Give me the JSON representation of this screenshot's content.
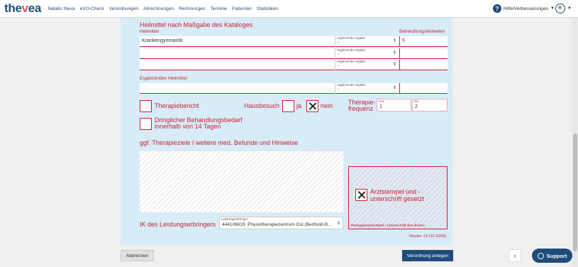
{
  "header": {
    "logo_main": "the",
    "logo_accent": "v",
    "logo_tail": "ea",
    "nav": [
      "Natalis theva",
      "eVO-Check",
      "Verordnungen",
      "Abrechnungen",
      "Rechnungen",
      "Termine",
      "Patienten",
      "Statistiken"
    ],
    "help_label": "Hilfe/Verbesserungen",
    "help_icon": "?"
  },
  "form": {
    "section_title": "Heilmittel nach Maßgabe des Kataloges",
    "heilmittel_label": "Heilmittel",
    "units_label": "Behandlungseinheiten",
    "rows": [
      {
        "heilmittel": "Krankengymnastik",
        "ergaenzend_caption": "ergänzende Angabe",
        "ergaenzend_value": "-",
        "units": "6"
      },
      {
        "heilmittel": "",
        "ergaenzend_caption": "ergänzende Angabe",
        "ergaenzend_value": "-",
        "units": ""
      },
      {
        "heilmittel": "",
        "ergaenzend_caption": "ergänzende Angabe",
        "ergaenzend_value": "-",
        "units": ""
      }
    ],
    "ergaenzendes_label": "Ergänzendes Heilmittel",
    "ergaenzendes_row": {
      "heilmittel": "",
      "ergaenzend_caption": "ergänzende Angabe",
      "ergaenzend_value": "-",
      "units": ""
    },
    "therapiebericht": "Therapiebericht",
    "hausbesuch": "Hausbesuch",
    "ja": "ja",
    "nein": "nein",
    "therapiefrequenz_line1": "Therapie-",
    "therapiefrequenz_line2": "frequenz",
    "freq_von_caption": "von",
    "freq_von_value": "1",
    "freq_bis_caption": "bis",
    "freq_bis_value": "2",
    "dringlich_line1": "Dringlicher Behandlungsbedarf",
    "dringlich_line2": "innerhalb von 14 Tagen",
    "therapieziele": "ggf. Therapieziele / weitere med. Befunde und Hinweise",
    "stamp_line1": "Arztstempel und -",
    "stamp_line2": "unterschrift gesetzt",
    "stamp_footer": "Vertragsarztstempel / Unterschrift des Arztes",
    "ik_label": "IK des Leistungserbringers",
    "leistungserbringer_caption": "Leistungserbringer",
    "leistungserbringer_value": "444106619: Physiotherapiezentrum Ost (Berthold-B...",
    "muster": "Muster 13 (10.2020)"
  },
  "buttons": {
    "cancel": "Abbrechen",
    "create": "Verordnung anlegen",
    "support": "Support",
    "side_arrow": "›"
  }
}
